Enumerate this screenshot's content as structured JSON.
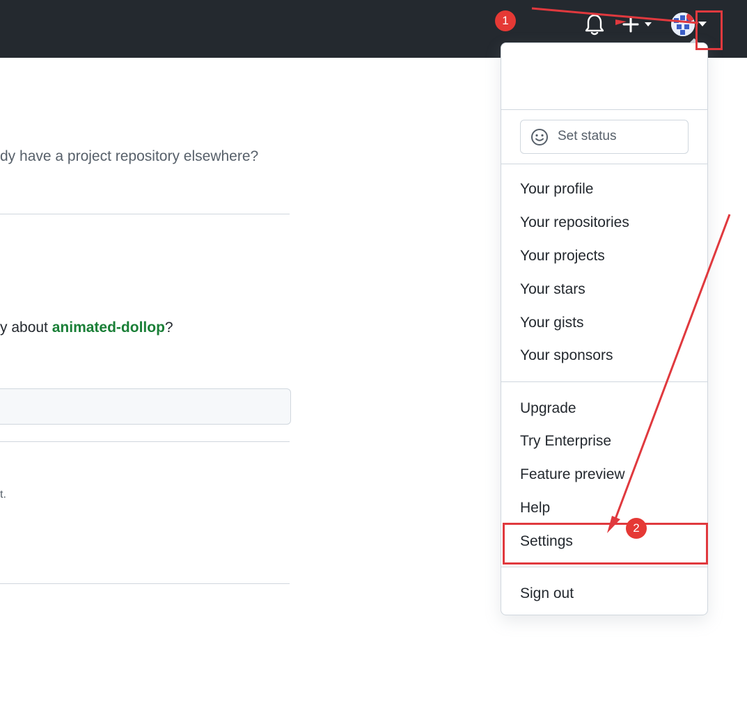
{
  "main": {
    "question_top": "dy have a project repository elsewhere?",
    "question_about_prefix": "y about ",
    "repo_name": "animated-dollop",
    "question_about_suffix": "?",
    "fragment_text": "t."
  },
  "menu": {
    "set_status": "Set status",
    "items": [
      "Your profile",
      "Your repositories",
      "Your projects",
      "Your stars",
      "Your gists",
      "Your sponsors",
      "Upgrade",
      "Try Enterprise",
      "Feature preview",
      "Help",
      "Settings",
      "Sign out"
    ]
  },
  "annotations": {
    "badge_1": "1",
    "badge_2": "2"
  },
  "colors": {
    "header_bg": "#24292f",
    "link_green": "#1a7f37",
    "annotation_red": "#e0393e"
  },
  "icons": [
    "bell-icon",
    "plus-icon",
    "chevron-down-icon",
    "avatar",
    "smiley-icon"
  ]
}
